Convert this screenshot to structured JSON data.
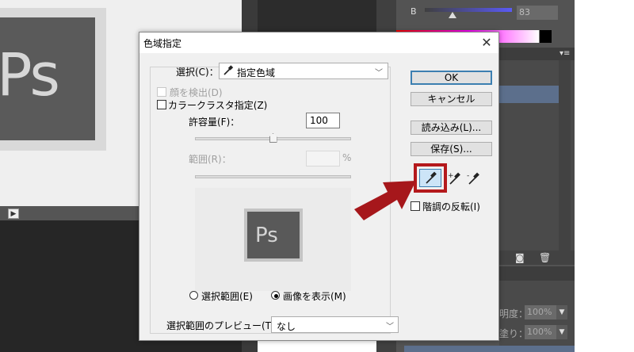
{
  "background": {
    "doc_logo_text": "Ps",
    "panel": {
      "channel_label": "B",
      "channel_value": "83",
      "opacity_label": "明度：",
      "opacity_value": "100%",
      "fill_label": "塗り：",
      "fill_value": "100%"
    }
  },
  "dialog": {
    "title": "色域指定",
    "close_glyph": "✕",
    "select": {
      "label": "選択(C)：",
      "value": "指定色域"
    },
    "detect_faces_label": "顔を検出(D)",
    "localized_clusters_label": "カラークラスタ指定(Z)",
    "fuzziness": {
      "label": "許容量(F)：",
      "value": "100",
      "slider_fraction": 0.5
    },
    "range": {
      "label": "範囲(R)：",
      "unit": "%"
    },
    "preview_logo_text": "Ps",
    "radio_selection_label": "選択範囲(E)",
    "radio_image_label": "画像を表示(M)",
    "preview_mode": {
      "label": "選択範囲のプレビュー(T)：",
      "value": "なし"
    },
    "buttons": {
      "ok": "OK",
      "cancel": "キャンセル",
      "load": "読み込み(L)...",
      "save": "保存(S)..."
    },
    "eyedropper_tools": [
      "eyedropper-icon",
      "eyedropper-plus-icon",
      "eyedropper-minus-icon"
    ],
    "invert_label": "階調の反転(I)"
  },
  "colors": {
    "highlight_red": "#b4191c",
    "arrow_red": "#a6171b",
    "focus_blue": "#3c7fb1"
  }
}
